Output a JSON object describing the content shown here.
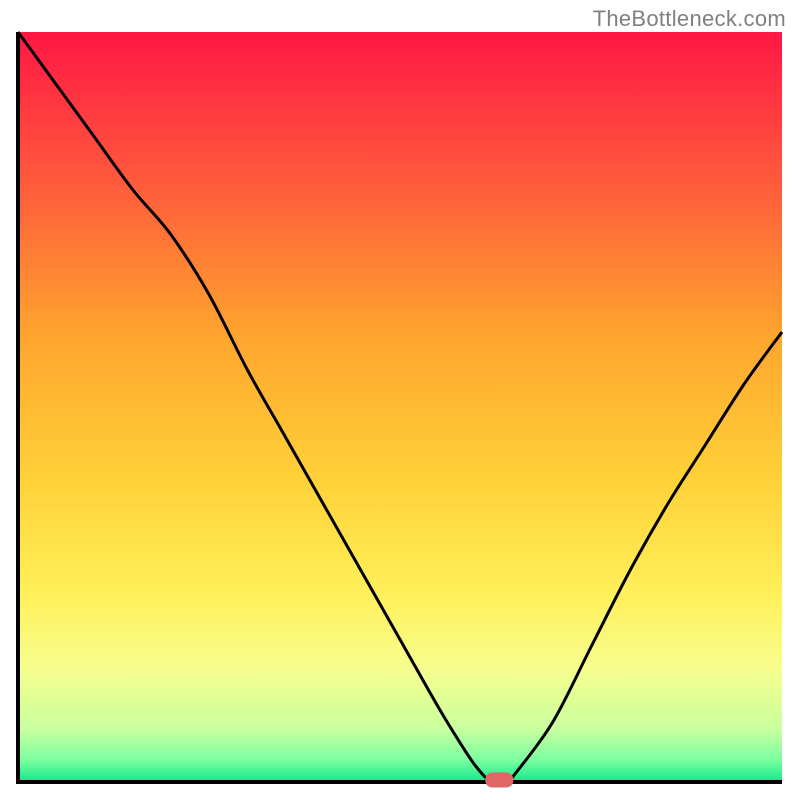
{
  "watermark": "TheBottleneck.com",
  "chart_data": {
    "type": "line",
    "title": "",
    "xlabel": "",
    "ylabel": "",
    "xlim": [
      0,
      100
    ],
    "ylim": [
      0,
      100
    ],
    "grid": false,
    "legend": false,
    "x": [
      0,
      5,
      10,
      15,
      20,
      25,
      30,
      35,
      40,
      45,
      50,
      55,
      58,
      60,
      62,
      64,
      65,
      70,
      75,
      80,
      85,
      90,
      95,
      100
    ],
    "values": [
      100,
      93,
      86,
      79,
      73,
      65,
      55,
      46,
      37,
      28,
      19,
      10,
      5,
      2,
      0,
      0,
      1,
      8,
      18,
      28,
      37,
      45,
      53,
      60
    ],
    "minimum_marker": {
      "x": 63,
      "y": 0
    },
    "background_gradient": {
      "stops": [
        {
          "offset": 0.0,
          "color": "#ff1744"
        },
        {
          "offset": 0.2,
          "color": "#ff5a3c"
        },
        {
          "offset": 0.4,
          "color": "#ffa32e"
        },
        {
          "offset": 0.6,
          "color": "#ffd238"
        },
        {
          "offset": 0.75,
          "color": "#fff05a"
        },
        {
          "offset": 0.85,
          "color": "#f7fe8e"
        },
        {
          "offset": 0.93,
          "color": "#c8ff9e"
        },
        {
          "offset": 0.97,
          "color": "#7dffa0"
        },
        {
          "offset": 1.0,
          "color": "#12e88c"
        }
      ]
    },
    "axis_color": "#000000",
    "curve_color": "#000000",
    "marker_color": "#e06666"
  }
}
